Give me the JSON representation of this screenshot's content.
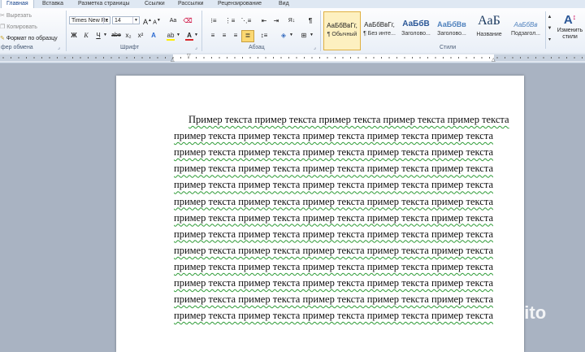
{
  "tabs": [
    "Главная",
    "Вставка",
    "Разметка страницы",
    "Ссылки",
    "Рассылки",
    "Рецензирование",
    "Вид"
  ],
  "clipboard": {
    "cut": "Вырезать",
    "copy": "Копировать",
    "format_painter": "Формат по образцу",
    "group_label": "фер обмена"
  },
  "font": {
    "name": "Times New Rc",
    "size": "14",
    "group_label": "Шрифт",
    "bold": "Ж",
    "italic": "К",
    "underline": "Ч",
    "strike": "abe",
    "subscript": "x₂",
    "superscript": "x²",
    "grow": "A",
    "shrink": "A",
    "clear": "Aa",
    "font_color": "A"
  },
  "paragraph": {
    "group_label": "Абзац",
    "pilcrow": "¶",
    "sort": "Я↓"
  },
  "styles": {
    "group_label": "Стили",
    "items": [
      {
        "sample": "АаБбВвГг,",
        "name": "¶ Обычный"
      },
      {
        "sample": "АаБбВвГг,",
        "name": "¶ Без инте..."
      },
      {
        "sample": "АаБбВ",
        "name": "Заголово..."
      },
      {
        "sample": "АаБбВв",
        "name": "Заголово..."
      },
      {
        "sample": "АаБ",
        "name": "Название"
      },
      {
        "sample": "АаБбВв",
        "name": "Подзагол..."
      }
    ],
    "change_styles": "Изменить стили"
  },
  "document": {
    "first_line": "Пример текста пример текста пример текста  пример текста пример  текста",
    "line_text": "пример  текста  пример  текста  пример  текста  пример  текста пример  текста",
    "line_count": 13
  },
  "watermark": "Avito",
  "colors": {
    "active_tab": "#15428b",
    "ribbon_border": "#b6c4d6",
    "squiggle": "#2e9b36",
    "font_color_bar": "#d9262a",
    "highlight_bar": "#ffee00"
  }
}
